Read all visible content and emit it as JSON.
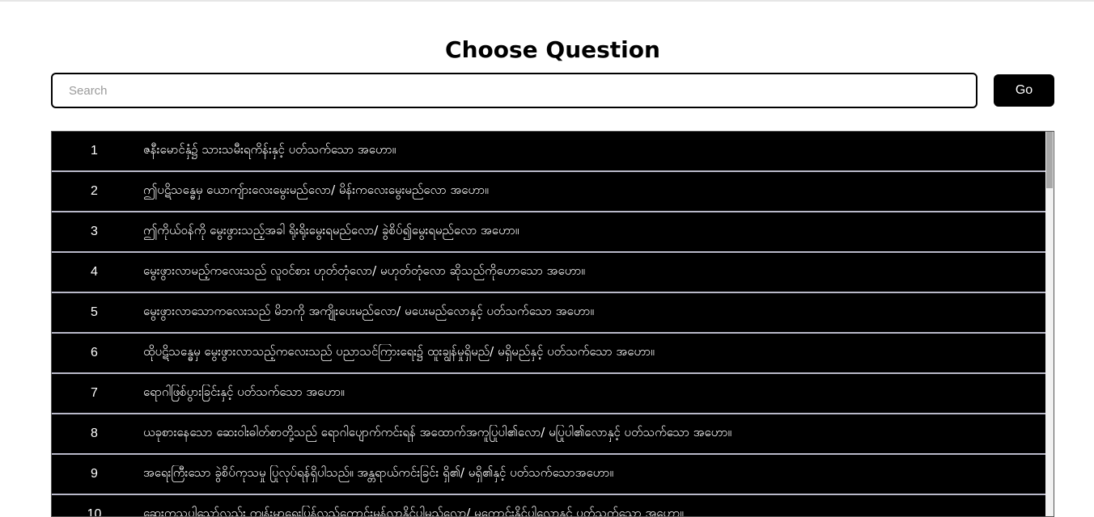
{
  "page": {
    "title": "Choose Question"
  },
  "search": {
    "placeholder": "Search",
    "value": ""
  },
  "go_button": {
    "label": "Go"
  },
  "questions": [
    {
      "num": "1",
      "text": "ဇနီးမောင်နှံ၌ သားသမီးရကိန်းနှင့် ပတ်သက်သော အဟော။"
    },
    {
      "num": "2",
      "text": "ဤပဋိသန္ဓေမှ ယောကျ်ားလေးမွေးမည်လော/ မိန်းကလေးမွေးမည်လော အဟော။"
    },
    {
      "num": "3",
      "text": "ဤကိုယ်ဝန်ကို မွေးဖွားသည့်အခါ ရိုးရိုးမွေးရမည်လော/ ခွဲစိပ်၍မွေးရမည်လော အဟော။"
    },
    {
      "num": "4",
      "text": "မွေးဖွားလာမည့်ကလေးသည် လူဝင်စား ဟုတ်တုံလော/ မဟုတ်တုံလော ဆိုသည်ကိုဟောသော အဟော။"
    },
    {
      "num": "5",
      "text": "မွေးဖွားလာသောကလေးသည် မိဘကို အကျိုးပေးမည်လော/ မပေးမည်လောနှင့် ပတ်သက်သော အဟော။"
    },
    {
      "num": "6",
      "text": "ထိုပဋိသန္ဓေမှ မွေးဖွားလာသည့်ကလေးသည် ပညာသင်ကြားရေး၌ ထူးချွန်မှုရှိမည်/ မရှိမည်နှင့် ပတ်သက်သော အဟော။"
    },
    {
      "num": "7",
      "text": "ရောဂါဖြစ်ပွားခြင်းနှင့် ပတ်သက်သော အဟော။"
    },
    {
      "num": "8",
      "text": "ယခုစားနေသော ဆေးဝါးဓါတ်စာတို့သည် ရောဂါပျောက်ကင်းရန် အထောက်အကူပြုပါ၏လော/ မပြုပါ၏လောနှင့် ပတ်သက်သော အဟော။"
    },
    {
      "num": "9",
      "text": "အရေးကြီးသော ခွဲစိပ်ကုသမှု ပြုလုပ်ရန်ရှိပါသည်။ အန္တရာယ်ကင်းခြင်း ရှိ၏/ မရှိ၏နှင့် ပတ်သက်သောအဟော။"
    },
    {
      "num": "10",
      "text": "ဆေးကုသပါသော်လည်း ကျန်းမာရေးပြန်လည်ကောင်းမွန်လာနိုင်ပါမည်လော/ မကောင်းနိုင်ပါလောနှင့် ပတ်သက်သော အဟော။"
    }
  ]
}
